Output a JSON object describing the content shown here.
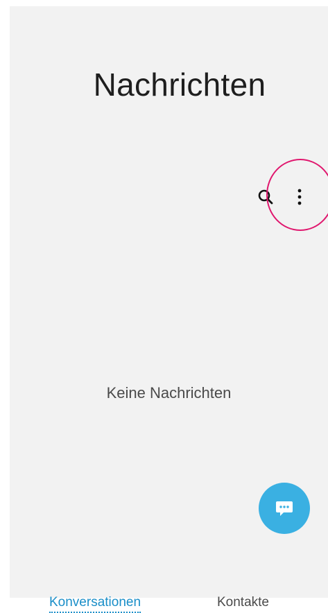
{
  "header": {
    "title": "Nachrichten"
  },
  "toolbar": {
    "search_icon": "search-icon",
    "more_icon": "more-vertical-icon"
  },
  "main": {
    "empty_state": "Keine Nachrichten"
  },
  "fab": {
    "icon": "chat-bubble-icon",
    "color": "#3ab0e2"
  },
  "tabs": [
    {
      "label": "Konversationen",
      "active": true
    },
    {
      "label": "Kontakte",
      "active": false
    }
  ],
  "colors": {
    "accent": "#1a8ec8",
    "highlight": "#e0176e",
    "background": "#f2f2f2"
  }
}
